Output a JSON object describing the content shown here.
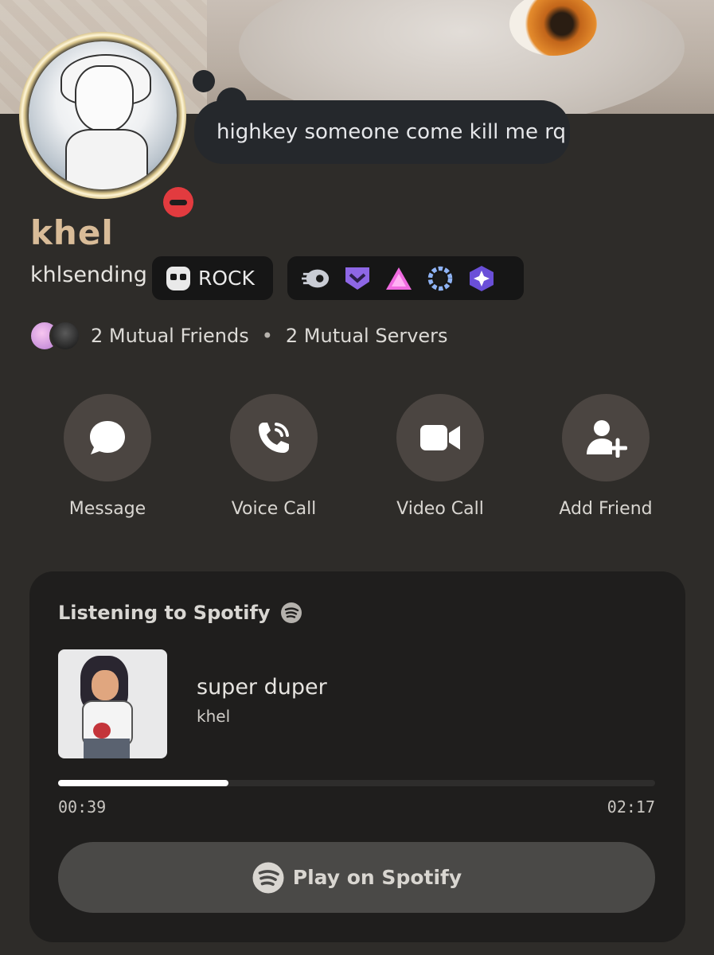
{
  "profile": {
    "status_text": "highkey someone come kill me rq",
    "display_name": "khel",
    "username": "khlsending",
    "tag": "ROCK",
    "status": "do-not-disturb",
    "badges": [
      "hypesquad-badge",
      "shield-badge",
      "triangle-badge",
      "laurel-badge",
      "gem-badge"
    ],
    "mutual_friends": "2 Mutual Friends",
    "separator": "•",
    "mutual_servers": "2 Mutual Servers"
  },
  "actions": {
    "message": "Message",
    "voice_call": "Voice Call",
    "video_call": "Video Call",
    "add_friend": "Add Friend"
  },
  "spotify": {
    "heading": "Listening to Spotify",
    "track_title": "super duper",
    "artist": "khel",
    "elapsed": "00:39",
    "duration": "02:17",
    "progress_fraction": 0.285,
    "play_label": "Play on Spotify"
  },
  "colors": {
    "background": "#2e2c29",
    "display_name": "#d9bc98",
    "dnd_red": "#e23b3f",
    "action_circle": "#4b4541"
  }
}
